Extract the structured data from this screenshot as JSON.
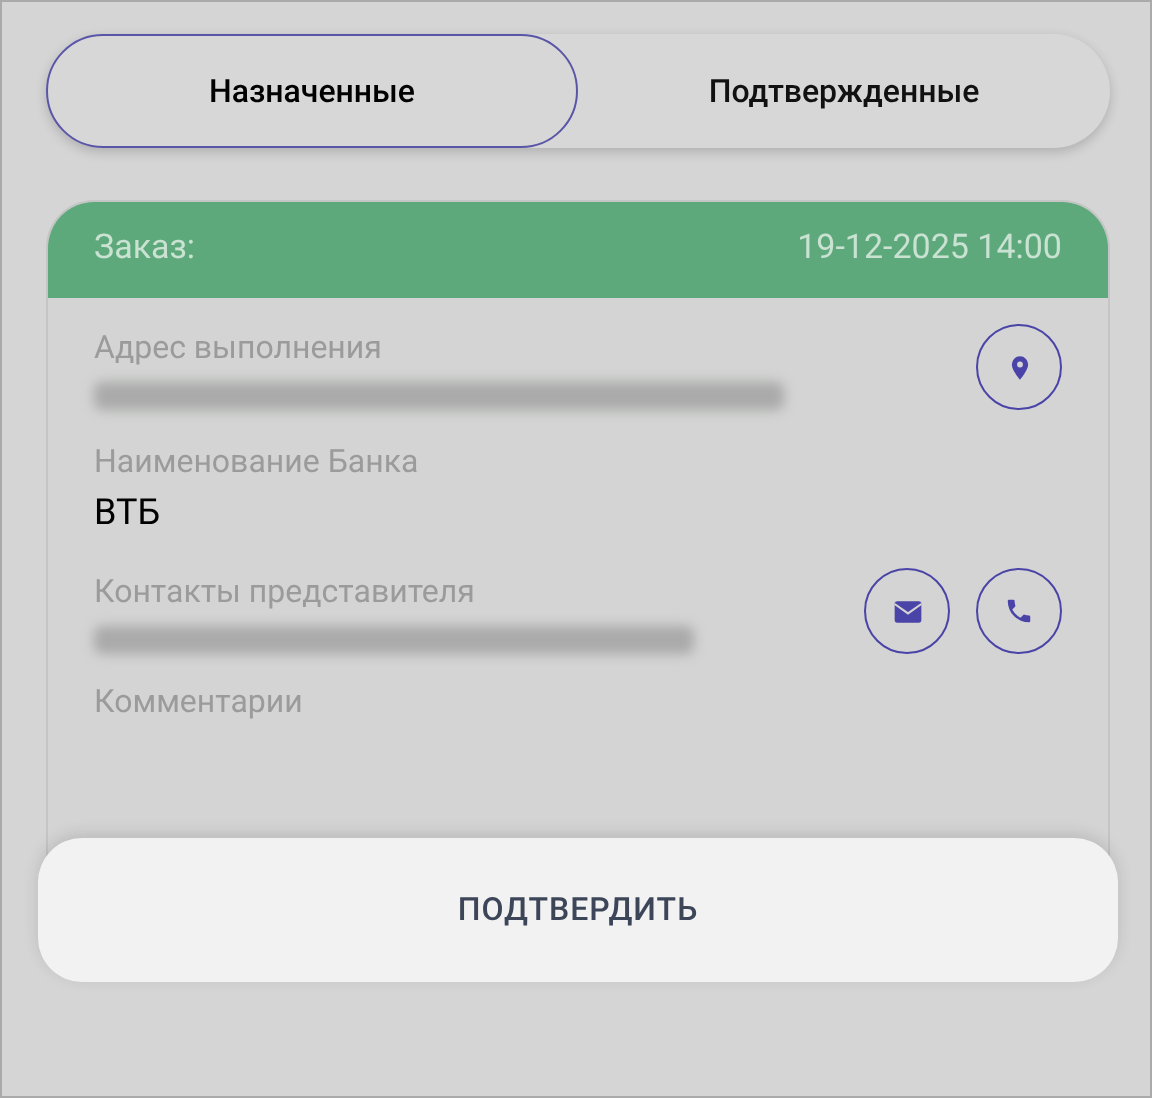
{
  "tabs": [
    {
      "label": "Назначенные",
      "selected": true
    },
    {
      "label": "Подтвержденные",
      "selected": false
    }
  ],
  "order": {
    "label": "Заказ:",
    "datetime": "19-12-2025 14:00",
    "fields": [
      {
        "kind": "address",
        "label": "Адрес выполнения",
        "blurred": true
      },
      {
        "kind": "plain",
        "label": "Наименование Банка",
        "value": "ВТБ"
      },
      {
        "kind": "contacts",
        "label": "Контакты представителя",
        "blurred": true
      },
      {
        "kind": "comment",
        "label": "Комментарии"
      }
    ]
  },
  "confirm_button": "ПОДТВЕРДИТЬ"
}
